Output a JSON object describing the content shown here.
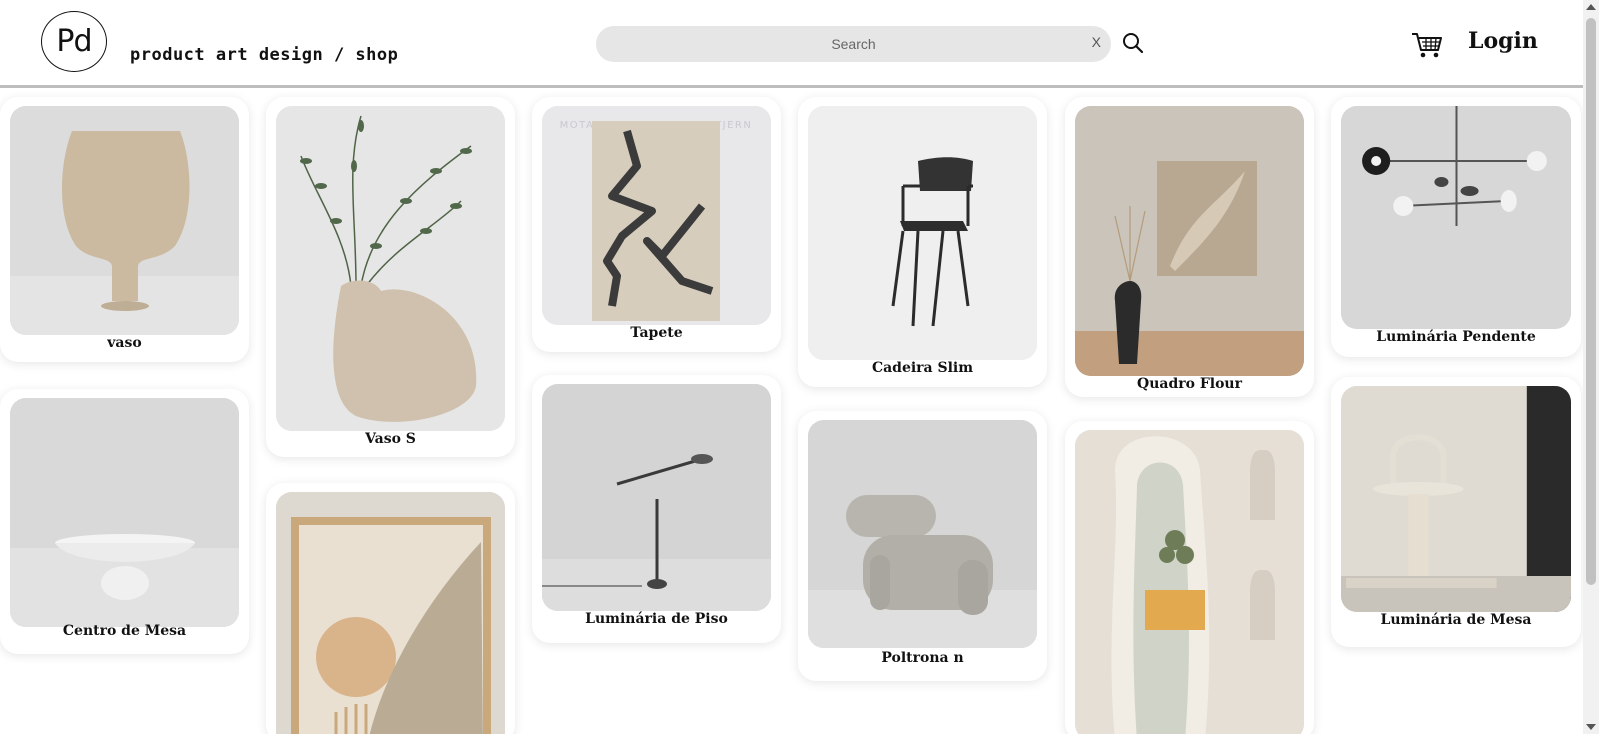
{
  "header": {
    "logo_text": "Pd",
    "brand_text": "product art design / shop",
    "search_placeholder": "Search",
    "search_clear": "X",
    "login_label": "Login"
  },
  "products": [
    {
      "name": "vaso"
    },
    {
      "name": "Centro de Mesa"
    },
    {
      "name": "Vaso S"
    },
    {
      "name": "Tapete",
      "image_overlay_text": "MOTARACI RVATA NORDSTJERN"
    },
    {
      "name": "Luminária de Piso"
    },
    {
      "name": "Cadeira Slim"
    },
    {
      "name": "Poltrona n"
    },
    {
      "name": "Quadro Flour"
    },
    {
      "name": "Luminária Pendente"
    },
    {
      "name": "Luminária de Mesa"
    }
  ],
  "colors": {
    "search_bg": "#e6e6e6",
    "header_border": "#bdbdbd",
    "card_bg": "#ffffff"
  }
}
